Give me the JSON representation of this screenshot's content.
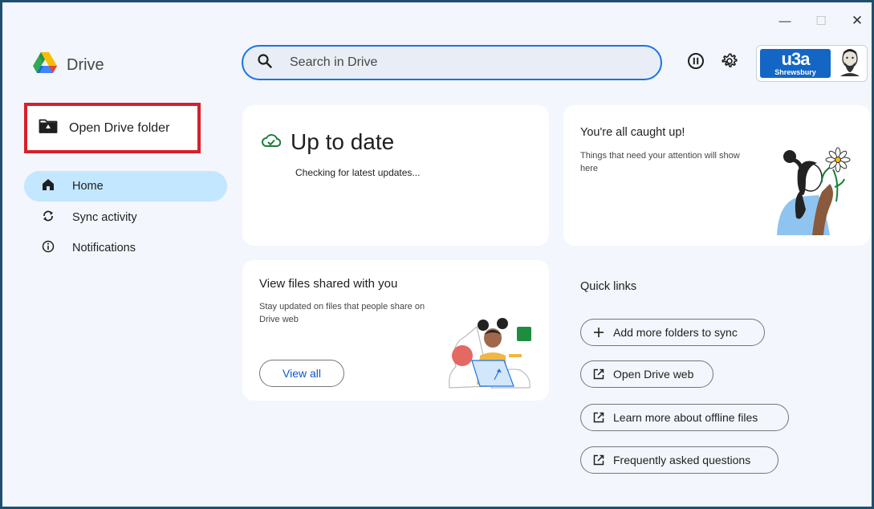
{
  "window": {
    "controls": {
      "minimize": "—",
      "maximize": "☐",
      "close": "✕"
    }
  },
  "app": {
    "name": "Drive"
  },
  "search": {
    "placeholder": "Search in Drive",
    "value": ""
  },
  "toolbar": {
    "pause_icon": "pause-icon",
    "settings_icon": "gear-icon"
  },
  "account": {
    "logo_big": "u3a",
    "logo_small": "Shrewsbury"
  },
  "sidebar": {
    "open_folder_label": "Open Drive folder",
    "items": [
      {
        "label": "Home",
        "icon": "home-icon",
        "active": true
      },
      {
        "label": "Sync activity",
        "icon": "sync-icon",
        "active": false
      },
      {
        "label": "Notifications",
        "icon": "info-icon",
        "active": false
      }
    ]
  },
  "status_card": {
    "title": "Up to date",
    "subtitle": "Checking for latest updates..."
  },
  "caught_card": {
    "title": "You're all caught up!",
    "subtitle": "Things that need your attention will show here"
  },
  "shared_card": {
    "title": "View files shared with you",
    "subtitle": "Stay updated on files that people share on Drive web",
    "button": "View all"
  },
  "quick_links": {
    "title": "Quick links",
    "items": [
      {
        "label": "Add more folders to sync",
        "icon": "plus-icon"
      },
      {
        "label": "Open Drive web",
        "icon": "open-external-icon"
      },
      {
        "label": "Learn more about offline files",
        "icon": "open-external-icon"
      },
      {
        "label": "Frequently asked questions",
        "icon": "open-external-icon"
      }
    ]
  },
  "colors": {
    "accent": "#1a73e8",
    "nav_active": "#c2e7ff",
    "highlight_border": "#d6202b",
    "window_border": "#1e4f6e"
  }
}
